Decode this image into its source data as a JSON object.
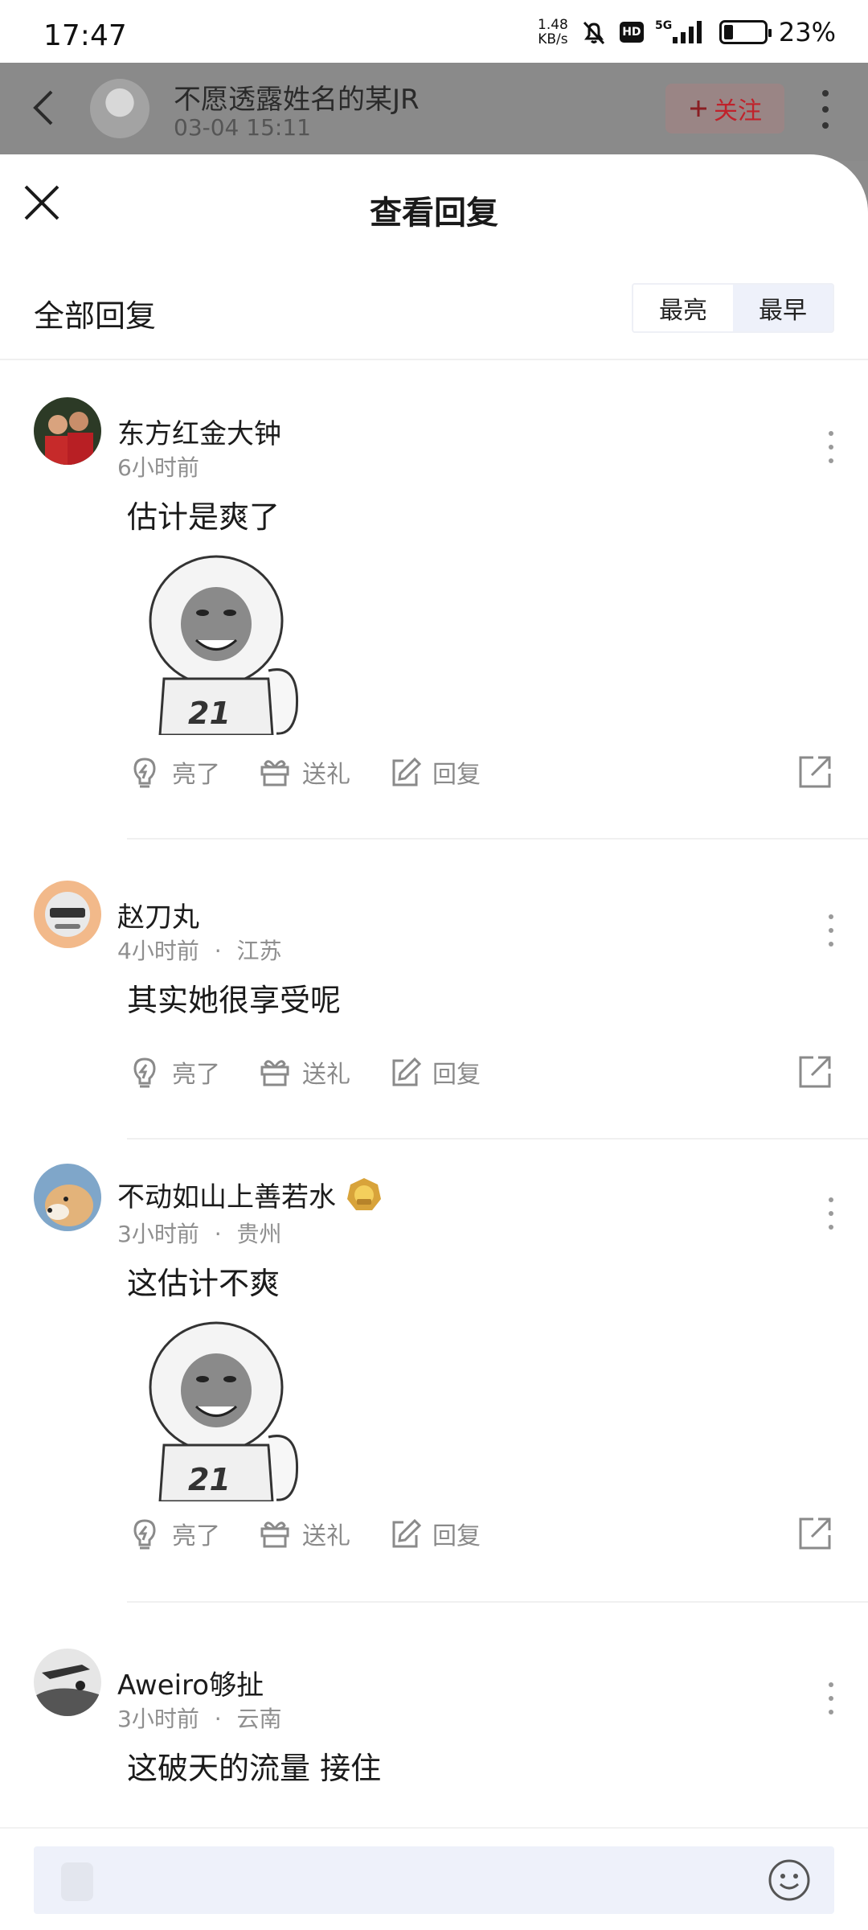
{
  "status_bar": {
    "time": "17:47",
    "net_speed_value": "1.48",
    "net_speed_unit": "KB/s",
    "hd": "HD",
    "network": "5G",
    "battery_percent": "23%",
    "battery_level": 0.23
  },
  "post_header": {
    "author": "不愿透露姓名的某JR",
    "datetime": "03-04 15:11",
    "follow_label": "关注"
  },
  "sheet": {
    "title": "查看回复",
    "filter_label": "全部回复",
    "sort_options": [
      "最亮",
      "最早"
    ],
    "active_sort": "最早"
  },
  "action_labels": {
    "like": "亮了",
    "gift": "送礼",
    "reply": "回复"
  },
  "comments": [
    {
      "username": "东方红金大钟",
      "time": "6小时前",
      "location": "",
      "text": "估计是爽了",
      "has_sticker": true
    },
    {
      "username": "赵刀丸",
      "time": "4小时前",
      "location": "江苏",
      "text": "其实她很享受呢",
      "has_sticker": false
    },
    {
      "username": "不动如山上善若水",
      "time": "3小时前",
      "location": "贵州",
      "text": "这估计不爽",
      "has_sticker": true,
      "badge": "medal-icon"
    },
    {
      "username": "Aweiro够扯",
      "time": "3小时前",
      "location": "云南",
      "text": "这破天的流量 接住",
      "has_sticker": false
    }
  ],
  "meta_separator": "·",
  "colors": {
    "follow_red": "#c0222b",
    "active_sort_bg": "#eef1fa",
    "meta_gray": "#8f8f8f"
  }
}
